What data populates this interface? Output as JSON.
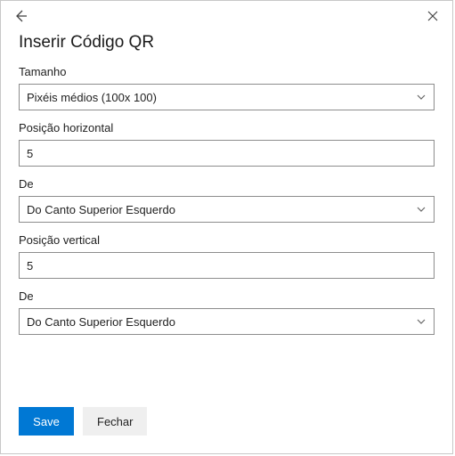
{
  "header": {
    "title": "Inserir Código QR"
  },
  "fields": {
    "size": {
      "label": "Tamanho",
      "value": "Pixéis médios (100x 100)"
    },
    "hpos": {
      "label": "Posição horizontal",
      "value": "5"
    },
    "hfrom": {
      "label": "De",
      "value": "Do Canto Superior Esquerdo"
    },
    "vpos": {
      "label": "Posição vertical",
      "value": "5"
    },
    "vfrom": {
      "label": "De",
      "value": "Do Canto Superior Esquerdo"
    }
  },
  "footer": {
    "save": "Save",
    "close": "Fechar"
  }
}
